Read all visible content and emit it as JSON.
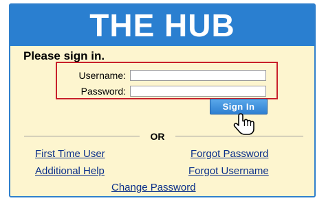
{
  "header": {
    "title": "THE HUB"
  },
  "form": {
    "prompt": "Please sign in.",
    "username_label": "Username:",
    "username_value": "",
    "password_label": "Password:",
    "password_value": "",
    "signin_label": "Sign In"
  },
  "divider": {
    "label": "OR"
  },
  "links": {
    "first_time_user": "First Time User",
    "forgot_password": "Forgot Password",
    "additional_help": "Additional Help",
    "forgot_username": "Forgot Username",
    "change_password": "Change Password"
  },
  "colors": {
    "banner": "#2a7fd0",
    "panel_bg": "#fdf5cf",
    "highlight_border": "#c8202a",
    "link": "#0b2f8a"
  },
  "icons": {
    "cursor": "hand-pointer-icon"
  }
}
